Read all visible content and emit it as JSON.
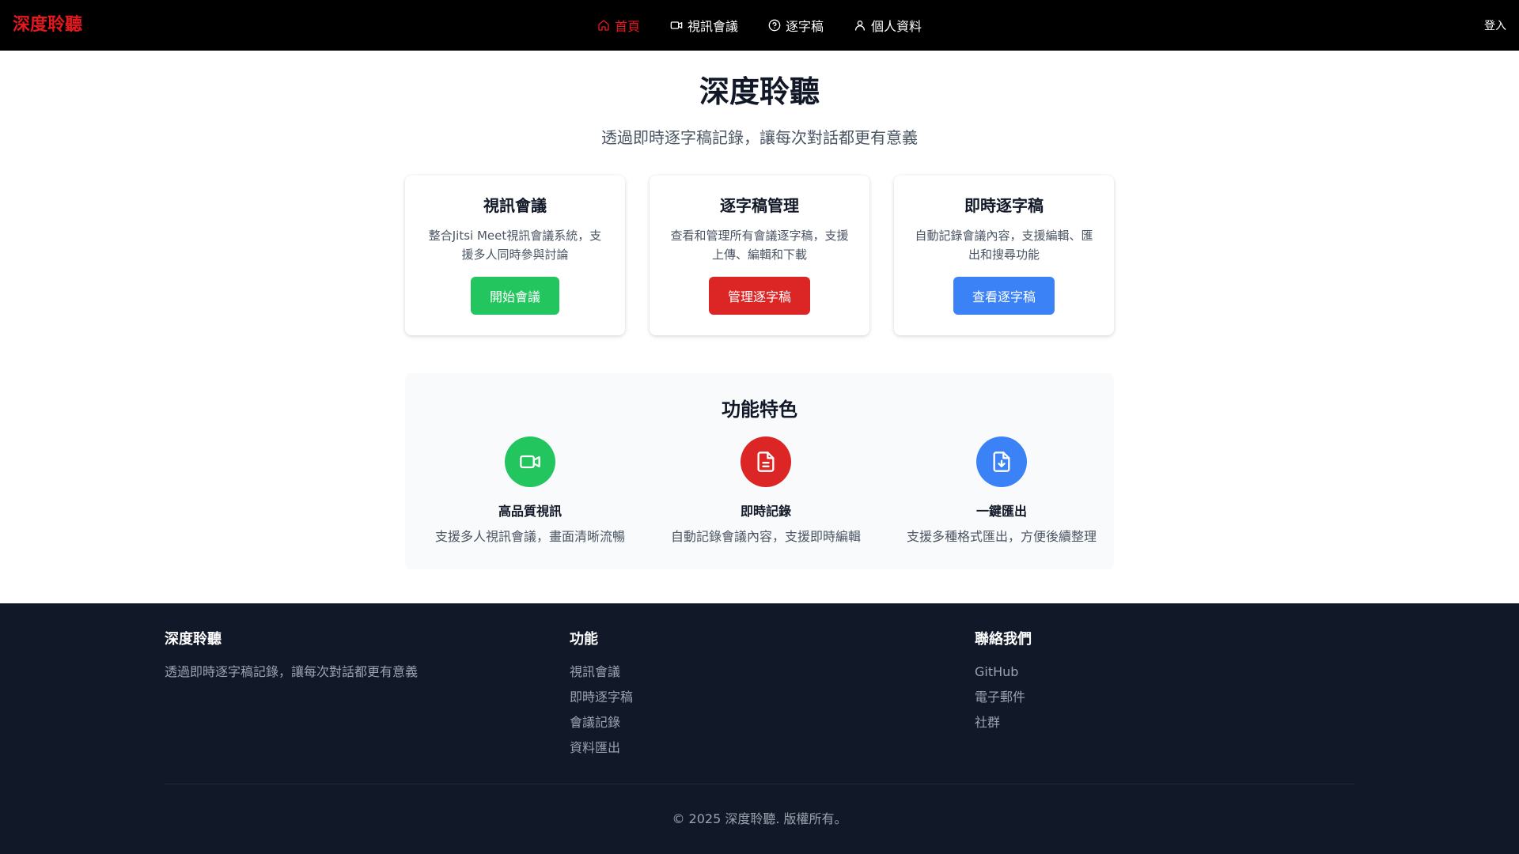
{
  "colors": {
    "brand": "#e3191f",
    "green": "#22c55e",
    "red": "#dc2626",
    "blue": "#3b82f6",
    "footer_bg": "#111827"
  },
  "header": {
    "brand": "深度聆聽",
    "nav": [
      {
        "label": "首頁",
        "icon": "home-icon",
        "active": true
      },
      {
        "label": "視訊會議",
        "icon": "video-icon",
        "active": false
      },
      {
        "label": "逐字稿",
        "icon": "help-circle-icon",
        "active": false
      },
      {
        "label": "個人資料",
        "icon": "user-icon",
        "active": false
      }
    ],
    "login": "登入"
  },
  "hero": {
    "title": "深度聆聽",
    "subtitle": "透過即時逐字稿記錄，讓每次對話都更有意義"
  },
  "cards": [
    {
      "title": "視訊會議",
      "desc": "整合Jitsi Meet視訊會議系統，支援多人同時參與討論",
      "button": "開始會議",
      "color": "green"
    },
    {
      "title": "逐字稿管理",
      "desc": "查看和管理所有會議逐字稿，支援上傳、編輯和下載",
      "button": "管理逐字稿",
      "color": "red"
    },
    {
      "title": "即時逐字稿",
      "desc": "自動記錄會議內容，支援編輯、匯出和搜尋功能",
      "button": "查看逐字稿",
      "color": "blue"
    }
  ],
  "features": {
    "title": "功能特色",
    "items": [
      {
        "icon": "video-icon",
        "title": "高品質視訊",
        "desc": "支援多人視訊會議，畫面清晰流暢",
        "color": "green"
      },
      {
        "icon": "document-icon",
        "title": "即時記錄",
        "desc": "自動記錄會議內容，支援即時編輯",
        "color": "red"
      },
      {
        "icon": "file-download-icon",
        "title": "一鍵匯出",
        "desc": "支援多種格式匯出，方便後續整理",
        "color": "blue"
      }
    ]
  },
  "footer": {
    "col1": {
      "title": "深度聆聽",
      "text": "透過即時逐字稿記錄，讓每次對話都更有意義"
    },
    "col2": {
      "title": "功能",
      "links": [
        "視訊會議",
        "即時逐字稿",
        "會議記錄",
        "資料匯出"
      ]
    },
    "col3": {
      "title": "聯絡我們",
      "links": [
        "GitHub",
        "電子郵件",
        "社群"
      ]
    },
    "copyright": "© 2025 深度聆聽. 版權所有。"
  }
}
